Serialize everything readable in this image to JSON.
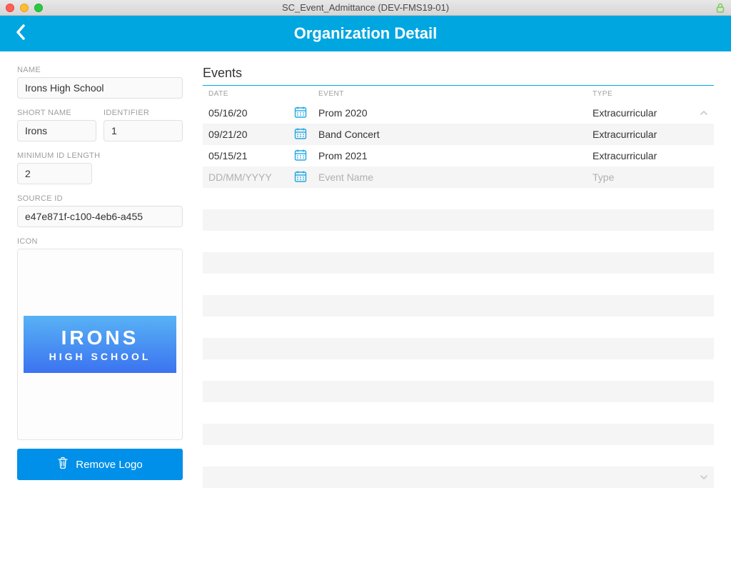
{
  "window": {
    "title": "SC_Event_Admittance (DEV-FMS19-01)"
  },
  "header": {
    "title": "Organization Detail"
  },
  "form": {
    "name_label": "NAME",
    "name_value": "Irons High School",
    "short_name_label": "SHORT NAME",
    "short_name_value": "Irons",
    "identifier_label": "IDENTIFIER",
    "identifier_value": "1",
    "min_id_length_label": "MINIMUM ID LENGTH",
    "min_id_length_value": "2",
    "source_id_label": "SOURCE ID",
    "source_id_value": "e47e871f-c100-4eb6-a455",
    "icon_label": "ICON",
    "logo_line1": "IRONS",
    "logo_line2": "HIGH SCHOOL",
    "remove_logo_label": "Remove Logo"
  },
  "events": {
    "section_title": "Events",
    "columns": {
      "date": "DATE",
      "event": "EVENT",
      "type": "TYPE"
    },
    "rows": [
      {
        "date": "05/16/20",
        "event": "Prom 2020",
        "type": "Extracurricular"
      },
      {
        "date": "09/21/20",
        "event": "Band Concert",
        "type": "Extracurricular"
      },
      {
        "date": "05/15/21",
        "event": "Prom 2021",
        "type": "Extracurricular"
      }
    ],
    "placeholder": {
      "date": "DD/MM/YYYY",
      "event": "Event Name",
      "type": "Type"
    }
  }
}
